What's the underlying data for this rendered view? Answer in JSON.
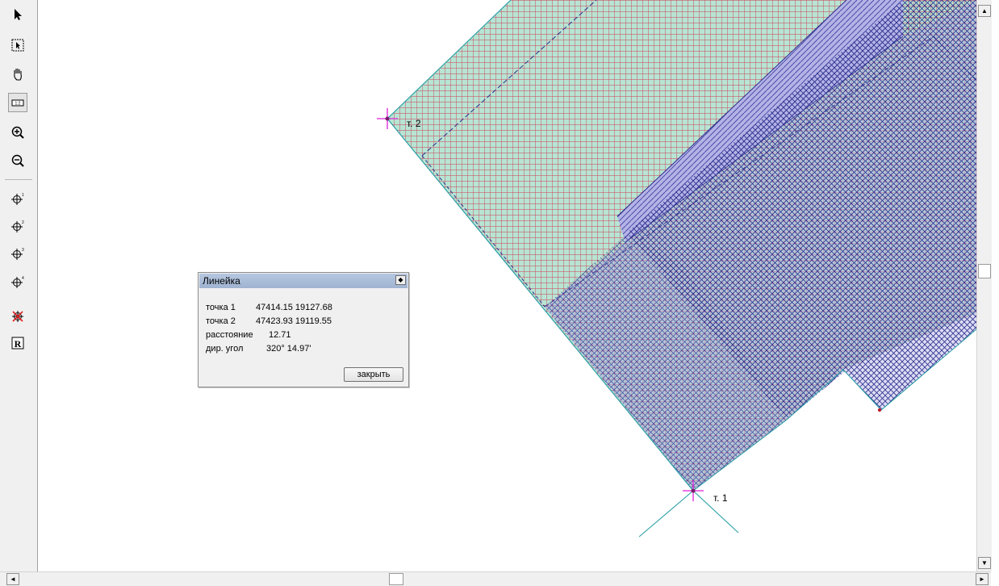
{
  "toolbar": {
    "tools": [
      {
        "name": "select-arrow-icon"
      },
      {
        "name": "select-rect-icon"
      },
      {
        "name": "pan-hand-icon"
      },
      {
        "name": "ruler-icon"
      },
      {
        "name": "zoom-in-icon"
      },
      {
        "name": "zoom-out-icon"
      },
      {
        "name": "point-1-icon"
      },
      {
        "name": "point-2-icon"
      },
      {
        "name": "point-3-icon"
      },
      {
        "name": "point-4-icon"
      },
      {
        "name": "delete-points-icon"
      },
      {
        "name": "r-icon"
      }
    ],
    "ruler_glyph": "1:2",
    "r_glyph": "R"
  },
  "map": {
    "point1_label": "т. 1",
    "point2_label": "т. 2",
    "colors": {
      "green_fill": "#b7e4d3",
      "purple_fill": "#b5b2e6",
      "hatch_red": "#d03a55",
      "hatch_dark": "#2a2f8c",
      "outline_teal": "#2aa0a6",
      "marker": "#e01fd8"
    }
  },
  "ruler_dialog": {
    "title": "Линейка",
    "rows": [
      {
        "label": "точка 1",
        "value": "47414.15 19127.68"
      },
      {
        "label": "точка 2",
        "value": "47423.93 19119.55"
      },
      {
        "label": "расстояние",
        "value": "12.71"
      },
      {
        "label": "дир. угол",
        "value": "320° 14.97'"
      }
    ],
    "close_label": "закрыть"
  },
  "scrollbars": {
    "up_arrow": "▲",
    "down_arrow": "▼",
    "left_arrow": "◄",
    "right_arrow": "►",
    "collapse_glyph": "◆"
  }
}
